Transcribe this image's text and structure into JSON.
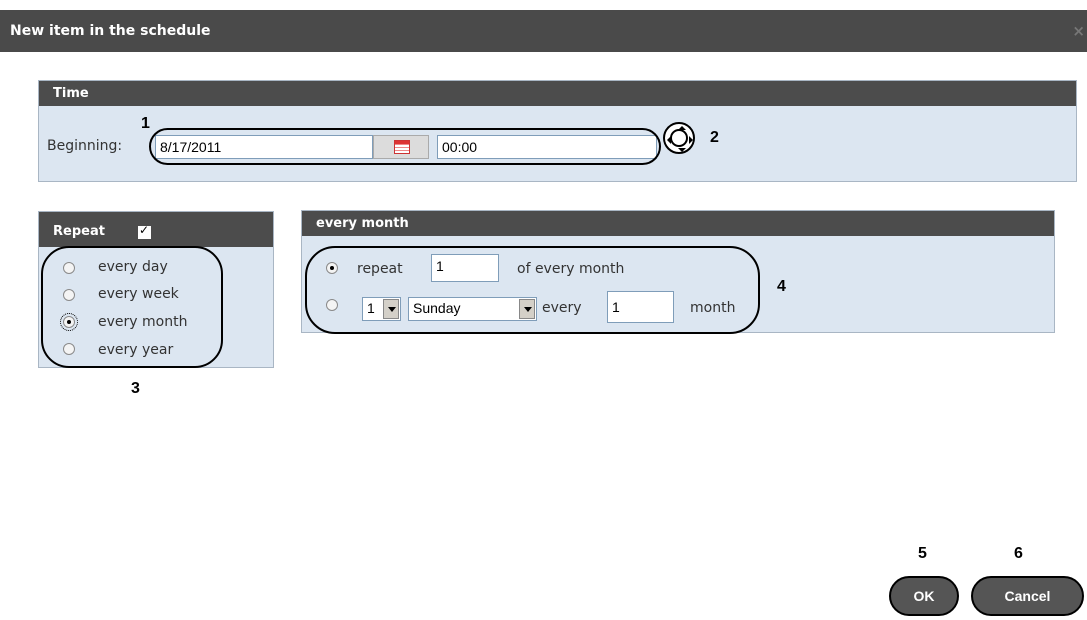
{
  "dialog": {
    "title": "New item in the schedule",
    "close_glyph": "×"
  },
  "time": {
    "header": "Time",
    "beginning_label": "Beginning:",
    "date_value": "8/17/2011",
    "time_value": "00:00"
  },
  "repeat": {
    "header": "Repeat",
    "checked": true,
    "options": [
      {
        "label": "every day",
        "selected": false
      },
      {
        "label": "every week",
        "selected": false
      },
      {
        "label": "every month",
        "selected": true
      },
      {
        "label": "every year",
        "selected": false
      }
    ]
  },
  "month_settings": {
    "header": "every month",
    "row1": {
      "label_repeat": "repeat",
      "day_value": "1",
      "label_suffix": "of every month",
      "selected": true
    },
    "row2": {
      "ordinal_value": "1",
      "weekday_value": "Sunday",
      "label_every": "every",
      "interval_value": "1",
      "label_month": "month",
      "selected": false
    }
  },
  "buttons": {
    "ok": "OK",
    "cancel": "Cancel"
  },
  "annotations": {
    "n1": "1",
    "n2": "2",
    "n3": "3",
    "n4": "4",
    "n5": "5",
    "n6": "6"
  },
  "icons": {
    "calendar": "calendar-icon",
    "navigate": "navigate-icon",
    "close": "close-icon"
  }
}
